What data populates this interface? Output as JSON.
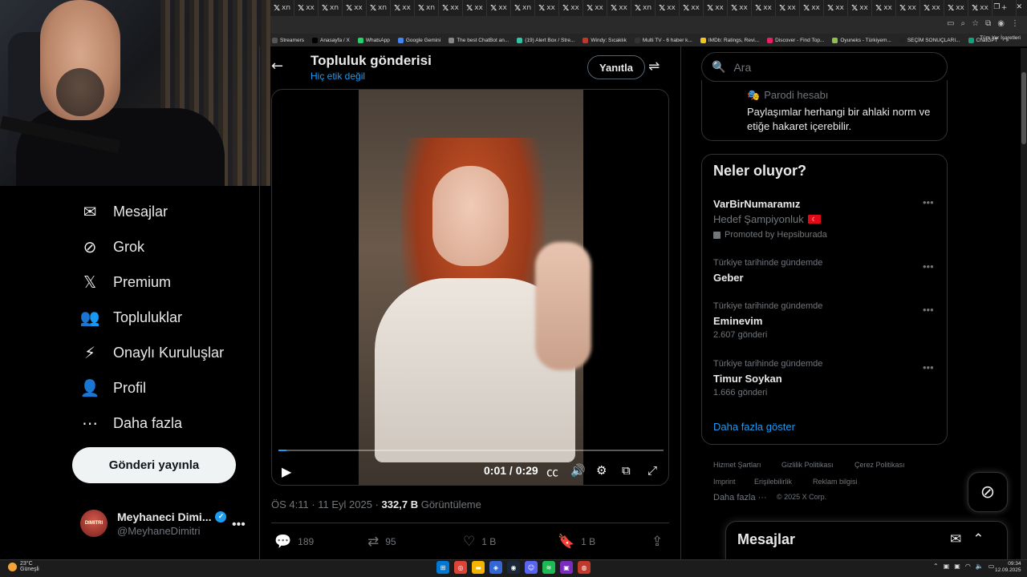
{
  "browser": {
    "tab_glyph": "𝕏",
    "tab_suffixes": [
      "xn",
      "xx",
      "xn",
      "xx",
      "xn",
      "xx",
      "xn",
      "xx",
      "xx",
      "xx",
      "xn",
      "xx",
      "xx",
      "xx",
      "xx",
      "xn",
      "xx",
      "xx",
      "xx",
      "xx",
      "xx",
      "xx",
      "xx",
      "xx",
      "xx",
      "xx",
      "xx",
      "xx",
      "xx",
      "xx"
    ],
    "new_tab": "+",
    "bookmarks": [
      {
        "label": "Streamers",
        "color": "#555"
      },
      {
        "label": "Anasayfa / X",
        "color": "#000"
      },
      {
        "label": "WhatsApp",
        "color": "#25d366"
      },
      {
        "label": "Google Gemini",
        "color": "#4285f4"
      },
      {
        "label": "The best ChatBot an...",
        "color": "#888"
      },
      {
        "label": "(19) Alert Box / Stre...",
        "color": "#31c3a2"
      },
      {
        "label": "Windy: Sıcaklık",
        "color": "#c0392b"
      },
      {
        "label": "Multi TV - 6 haber k...",
        "color": "#333"
      },
      {
        "label": "IMDb: Ratings, Revi...",
        "color": "#f5c518"
      },
      {
        "label": "Discover - Find Top...",
        "color": "#e91e63"
      },
      {
        "label": "Oyuneks - Türkiyem...",
        "color": "#8bc34a"
      },
      {
        "label": "SEÇİM SONUÇLARI...",
        "color": "#222"
      },
      {
        "label": "ChatGPT",
        "color": "#10a37f"
      }
    ],
    "bookmarks_more": "»",
    "all_bookmarks": "Tüm Yer İşaretleri"
  },
  "sidebar": {
    "items": [
      {
        "label": "Mesajlar",
        "icon": "✉"
      },
      {
        "label": "Grok",
        "icon": "⊘"
      },
      {
        "label": "Premium",
        "icon": "𝕏"
      },
      {
        "label": "Topluluklar",
        "icon": "👥"
      },
      {
        "label": "Onaylı Kuruluşlar",
        "icon": "⚡"
      },
      {
        "label": "Profil",
        "icon": "👤"
      },
      {
        "label": "Daha fazla",
        "icon": "⋯"
      }
    ],
    "post_button": "Gönderi yayınla",
    "account": {
      "avatar_text": "DIMITRI",
      "name": "Meyhaneci Dimi...",
      "verified": "✓",
      "handle": "@MeyhaneDimitri",
      "more": "•••"
    }
  },
  "header": {
    "back": "←",
    "title": "Topluluk gönderisi",
    "subtitle": "Hiç etik değil",
    "reply_button": "Yanıtla",
    "filter_icon": "⇌"
  },
  "video": {
    "time": "0:01 / 0:29",
    "progress": 0.02,
    "play": "▶",
    "cc": "㏄",
    "volume": "🔊",
    "settings": "⚙",
    "pip": "⧉",
    "fullscreen": "⤢"
  },
  "post_meta": {
    "time": "ÖS 4:11 · 11 Eyl 2025 · ",
    "views": "332,7 B",
    "views_label": " Görüntüleme"
  },
  "actions": {
    "replies": "189",
    "reposts": "95",
    "likes": "1 B",
    "bookmarks": "1 B"
  },
  "right": {
    "search_placeholder": "Ara",
    "parody_label": "Parodi hesabı",
    "parody_text": "Paylaşımlar herhangi bir ahlaki norm ve etiğe hakaret içerebilir.",
    "trends_title": "Neler oluyor?",
    "promo": {
      "name": "VarBirNumaramız",
      "sub": "Hedef Şampiyonluk",
      "by": "Promoted by Hepsiburada"
    },
    "trends": [
      {
        "context": "Türkiye tarihinde gündemde",
        "name": "Geber",
        "count": ""
      },
      {
        "context": "Türkiye tarihinde gündemde",
        "name": "Eminevim",
        "count": "2.607 gönderi"
      },
      {
        "context": "Türkiye tarihinde gündemde",
        "name": "Timur Soykan",
        "count": "1.666 gönderi"
      }
    ],
    "show_more": "Daha fazla göster",
    "footer": [
      "Hizmet Şartları",
      "Gizlilik Politikası",
      "Çerez Politikası",
      "Imprint",
      "Erişilebilirlik",
      "Reklam bilgisi",
      "Daha fazla ···",
      "© 2025 X Corp."
    ],
    "dock_title": "Mesajlar"
  },
  "taskbar": {
    "temp": "23°C",
    "weather": "Güneşli",
    "time": "09:34",
    "date": "12.09.2025"
  },
  "colors": {
    "accent": "#1d9bf0",
    "bg": "#000000",
    "border": "#2f3336"
  }
}
